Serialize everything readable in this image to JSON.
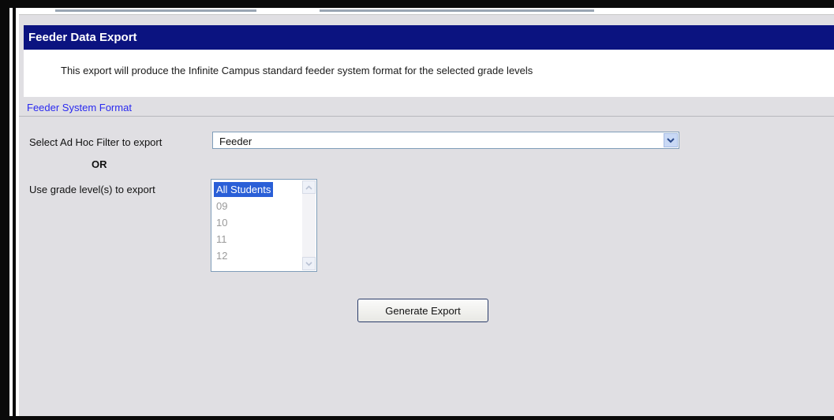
{
  "header": {
    "title": "Feeder Data Export"
  },
  "description": "This export will produce the Infinite Campus standard feeder system format for the selected grade levels",
  "section": {
    "label": "Feeder System Format"
  },
  "form": {
    "filter_label": "Select Ad Hoc Filter to export",
    "filter_value": "Feeder",
    "or_label": "OR",
    "grade_label": "Use grade level(s) to export",
    "grade_options": [
      "All Students",
      "09",
      "10",
      "11",
      "12"
    ],
    "grade_selected": "All Students"
  },
  "actions": {
    "generate_label": "Generate Export"
  },
  "colors": {
    "header_bg": "#0b1380",
    "section_link": "#2a2af0",
    "selection": "#2a5fd7",
    "panel_bg": "#e0dfe3"
  },
  "icons": {
    "dropdown": "chevron-down-icon",
    "scroll_up": "chevron-up-icon",
    "scroll_down": "chevron-down-icon"
  }
}
